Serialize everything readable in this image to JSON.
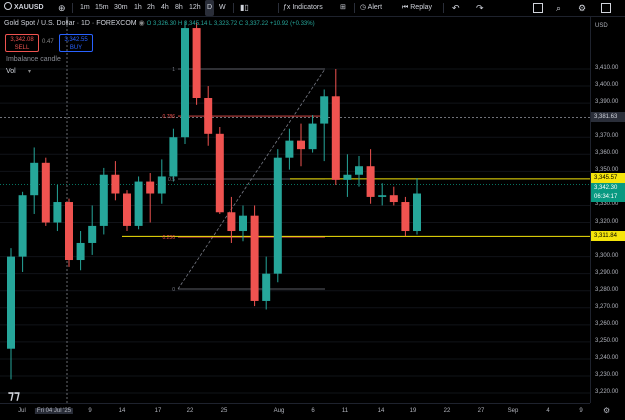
{
  "toolbar": {
    "symbol": "XAUUSD",
    "intervals": [
      "1m",
      "15m",
      "30m",
      "1h",
      "2h",
      "4h",
      "8h",
      "12h",
      "D",
      "W"
    ],
    "selected_interval": "D",
    "indicators_label": "Indicators",
    "alert_label": "Alert",
    "replay_label": "Replay"
  },
  "legend": {
    "title": "Gold Spot / U.S. Dollar · 1D · FOREXCOM",
    "ohlc": "O 3,326.30  H 3,345.14  L 3,323.72  C 3,337.22  +10.92 (+0.33%)",
    "sell_price": "3,342.08",
    "sell_label": "SELL",
    "spread": "0.47",
    "buy_price": "3,342.55",
    "buy_label": "BUY",
    "indicator_name": "Imbalance candle",
    "vol_label": "Vol"
  },
  "price_scale": {
    "currency": "USD",
    "ticks": [
      "3,410.00",
      "3,400.00",
      "3,390.00",
      "3,370.00",
      "3,360.00",
      "3,350.00",
      "3,330.00",
      "3,320.00",
      "3,300.00",
      "3,290.00",
      "3,280.00",
      "3,270.00",
      "3,260.00",
      "3,250.00",
      "3,240.00",
      "3,230.00",
      "3,220.00"
    ],
    "crosshair_price": "3,381.63",
    "hline_high": "3,345.57",
    "last_price": "3,342.30",
    "countdown": "06:34:17",
    "hline_low": "3,311.84"
  },
  "time_scale": {
    "labels": [
      "Jul",
      "Fri 04 Jul '25",
      "9",
      "14",
      "17",
      "22",
      "25",
      "Aug",
      "6",
      "11",
      "14",
      "19",
      "22",
      "27",
      "Sep",
      "4",
      "9"
    ]
  },
  "fib": {
    "levels": [
      "1",
      "0.786",
      "0.5",
      "0.236",
      "0"
    ]
  },
  "colors": {
    "up": "#26a69a",
    "down": "#ef5350",
    "hline": "#f5e50a",
    "bg": "#000000"
  },
  "chart_data": {
    "type": "candlestick",
    "ylim": [
      3220,
      3430
    ],
    "candles": [
      {
        "o": 3246,
        "h": 3305,
        "l": 3228,
        "c": 3300
      },
      {
        "o": 3300,
        "h": 3338,
        "l": 3291,
        "c": 3336
      },
      {
        "o": 3336,
        "h": 3364,
        "l": 3325,
        "c": 3355
      },
      {
        "o": 3355,
        "h": 3358,
        "l": 3318,
        "c": 3320
      },
      {
        "o": 3320,
        "h": 3342,
        "l": 3315,
        "c": 3332
      },
      {
        "o": 3332,
        "h": 3334,
        "l": 3294,
        "c": 3298
      },
      {
        "o": 3298,
        "h": 3315,
        "l": 3292,
        "c": 3308
      },
      {
        "o": 3308,
        "h": 3330,
        "l": 3301,
        "c": 3318
      },
      {
        "o": 3318,
        "h": 3352,
        "l": 3313,
        "c": 3348
      },
      {
        "o": 3348,
        "h": 3356,
        "l": 3333,
        "c": 3337
      },
      {
        "o": 3337,
        "h": 3339,
        "l": 3315,
        "c": 3318
      },
      {
        "o": 3318,
        "h": 3347,
        "l": 3316,
        "c": 3344
      },
      {
        "o": 3344,
        "h": 3349,
        "l": 3320,
        "c": 3337
      },
      {
        "o": 3337,
        "h": 3357,
        "l": 3331,
        "c": 3347
      },
      {
        "o": 3347,
        "h": 3375,
        "l": 3344,
        "c": 3370
      },
      {
        "o": 3370,
        "h": 3438,
        "l": 3366,
        "c": 3434
      },
      {
        "o": 3434,
        "h": 3437,
        "l": 3389,
        "c": 3393
      },
      {
        "o": 3393,
        "h": 3400,
        "l": 3365,
        "c": 3372
      },
      {
        "o": 3372,
        "h": 3376,
        "l": 3325,
        "c": 3326
      },
      {
        "o": 3326,
        "h": 3335,
        "l": 3308,
        "c": 3315
      },
      {
        "o": 3315,
        "h": 3330,
        "l": 3309,
        "c": 3324
      },
      {
        "o": 3324,
        "h": 3330,
        "l": 3271,
        "c": 3274
      },
      {
        "o": 3274,
        "h": 3300,
        "l": 3269,
        "c": 3290
      },
      {
        "o": 3290,
        "h": 3363,
        "l": 3285,
        "c": 3358
      },
      {
        "o": 3358,
        "h": 3375,
        "l": 3351,
        "c": 3368
      },
      {
        "o": 3368,
        "h": 3378,
        "l": 3353,
        "c": 3363
      },
      {
        "o": 3363,
        "h": 3383,
        "l": 3361,
        "c": 3378
      },
      {
        "o": 3378,
        "h": 3398,
        "l": 3356,
        "c": 3394
      },
      {
        "o": 3394,
        "h": 3410,
        "l": 3342,
        "c": 3345
      },
      {
        "o": 3345,
        "h": 3360,
        "l": 3335,
        "c": 3348
      },
      {
        "o": 3348,
        "h": 3359,
        "l": 3341,
        "c": 3353
      },
      {
        "o": 3353,
        "h": 3363,
        "l": 3331,
        "c": 3335
      },
      {
        "o": 3335,
        "h": 3343,
        "l": 3330,
        "c": 3336
      },
      {
        "o": 3336,
        "h": 3341,
        "l": 3330,
        "c": 3332
      },
      {
        "o": 3332,
        "h": 3335,
        "l": 3312,
        "c": 3315
      },
      {
        "o": 3315,
        "h": 3346,
        "l": 3313,
        "c": 3337
      }
    ]
  }
}
